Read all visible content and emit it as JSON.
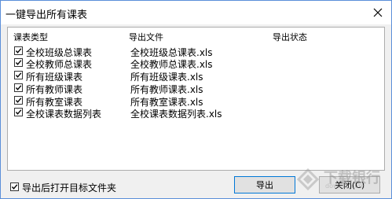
{
  "window": {
    "title": "一键导出所有课表"
  },
  "table": {
    "headers": {
      "type": "课表类型",
      "file": "导出文件",
      "status": "导出状态"
    },
    "rows": [
      {
        "type": "全校班级总课表",
        "file": "全校班级总课表.xls",
        "status": "",
        "checked": true
      },
      {
        "type": "全校教师总课表",
        "file": "全校教师总课表.xls",
        "status": "",
        "checked": true
      },
      {
        "type": "所有班级课表",
        "file": "所有班级课表.xls",
        "status": "",
        "checked": true
      },
      {
        "type": "所有教师课表",
        "file": "所有教师课表.xls",
        "status": "",
        "checked": true
      },
      {
        "type": "所有教室课表",
        "file": "所有教室课表.xls",
        "status": "",
        "checked": true
      },
      {
        "type": "全校课表数据列表",
        "file": "全校课表数据列表.xls",
        "status": "",
        "checked": true
      }
    ]
  },
  "footer": {
    "open_folder_label": "导出后打开目标文件夹",
    "open_folder_checked": true,
    "export_label": "导出",
    "close_label": "关闭(C)"
  },
  "watermark": {
    "text": "下载银行",
    "sub": "downcc.com"
  },
  "colors": {
    "window_border": "#5b8fd9",
    "dialog_bg": "#f0f0f0",
    "button_focus": "#0078d7"
  }
}
